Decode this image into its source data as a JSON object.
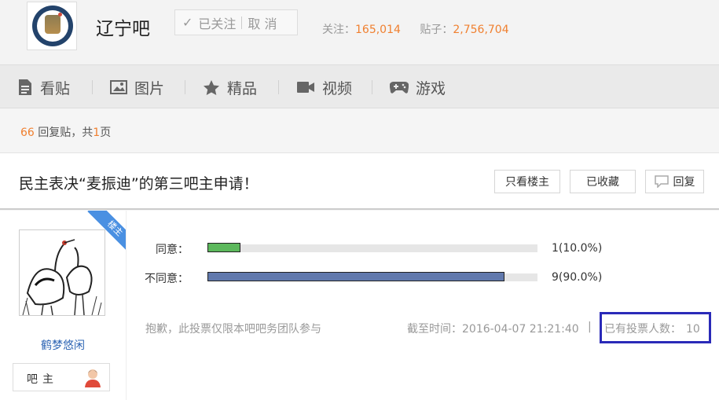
{
  "forum": {
    "name": "辽宁吧",
    "follow_button": {
      "check": "✓",
      "state": "已关注",
      "cancel": "取 消"
    },
    "stats": {
      "follow_label": "关注：",
      "follow_count": "165,014",
      "posts_label": "贴子：",
      "posts_count": "2,756,704"
    }
  },
  "nav": {
    "items": [
      {
        "label": "看贴",
        "icon": "document-icon"
      },
      {
        "label": "图片",
        "icon": "image-icon"
      },
      {
        "label": "精品",
        "icon": "star-icon"
      },
      {
        "label": "视频",
        "icon": "video-icon"
      },
      {
        "label": "游戏",
        "icon": "gamepad-icon"
      }
    ]
  },
  "pager": {
    "reply_count": "66",
    "reply_label": " 回复贴，共",
    "pages": "1",
    "pages_suffix": "页"
  },
  "thread": {
    "title": "民主表决“麦振迪”的第三吧主申请！",
    "buttons": {
      "only_op": "只看楼主",
      "favorited": "已收藏",
      "reply": "回复"
    }
  },
  "post": {
    "badge": "楼主",
    "username": "鹤梦悠闲",
    "role": "吧主"
  },
  "vote": {
    "options": [
      {
        "label": "同意：",
        "count_text": "1(10.0%)",
        "fraction": 0.1,
        "color": "#5cb85c"
      },
      {
        "label": "不同意：",
        "count_text": "9(90.0%)",
        "fraction": 0.9,
        "color": "#6179ad"
      }
    ],
    "note": "抱歉，此投票仅限本吧吧务团队参与",
    "deadline": "截至时间：2016-04-07 21:21:40",
    "divider": "|",
    "voters_label": "已有投票人数：",
    "voters_count": "10"
  },
  "colors": {
    "accent": "#f08030",
    "link": "#2d64b3",
    "highlight_box": "#2a2ab8"
  }
}
